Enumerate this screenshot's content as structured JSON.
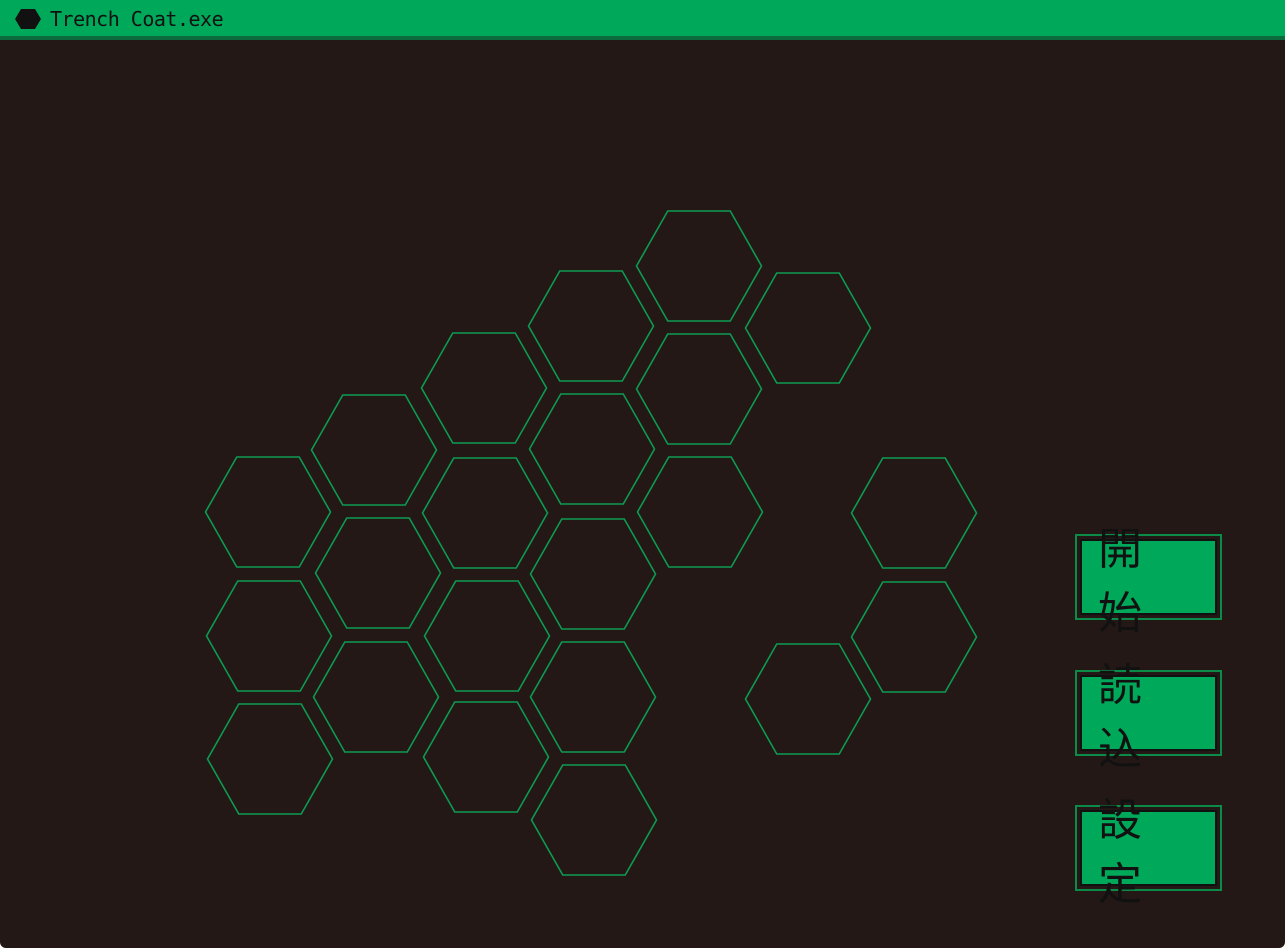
{
  "window": {
    "title": "Trench Coat.exe",
    "icon": "hexagon-icon"
  },
  "colors": {
    "background": "#231815",
    "accent": "#00a85a",
    "hex_stroke": "#0d9a52",
    "text": "#111111"
  },
  "hexagons": [
    {
      "id": "hex-1"
    },
    {
      "id": "hex-2"
    },
    {
      "id": "hex-3"
    },
    {
      "id": "hex-4"
    },
    {
      "id": "hex-5"
    },
    {
      "id": "hex-6"
    },
    {
      "id": "hex-7"
    },
    {
      "id": "hex-8"
    },
    {
      "id": "hex-9"
    },
    {
      "id": "hex-10"
    },
    {
      "id": "hex-11"
    },
    {
      "id": "hex-12"
    },
    {
      "id": "hex-13"
    },
    {
      "id": "hex-14"
    },
    {
      "id": "hex-15"
    },
    {
      "id": "hex-16"
    },
    {
      "id": "hex-17"
    },
    {
      "id": "hex-18"
    },
    {
      "id": "hex-19"
    },
    {
      "id": "hex-20"
    },
    {
      "id": "hex-21"
    },
    {
      "id": "hex-22"
    },
    {
      "id": "hex-23"
    }
  ],
  "menu": {
    "start_label": "開始",
    "load_label": "読込",
    "settings_label": "設定"
  }
}
